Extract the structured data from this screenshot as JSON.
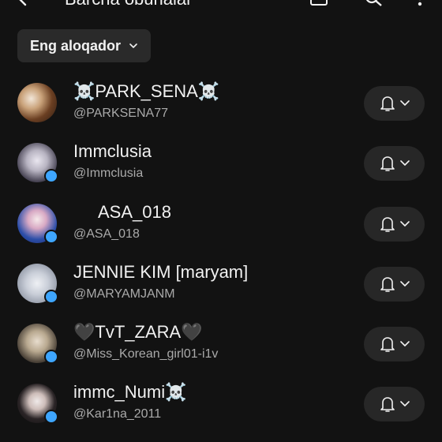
{
  "header": {
    "title": "Barcha obunalar"
  },
  "filter": {
    "label": "Eng aloqador"
  },
  "channels": [
    {
      "name": "☠️PARK_SENA☠️",
      "handle": "@PARKSENA77",
      "new_content": false
    },
    {
      "name": "Immclusia",
      "handle": "@Immclusia",
      "new_content": true
    },
    {
      "name": "ASA_018",
      "handle": "@ASA_018",
      "new_content": true
    },
    {
      "name": "JENNIE KIM [maryam]",
      "handle": "@MARYAMJANM",
      "new_content": true
    },
    {
      "name": "🖤TvT_ZARA🖤",
      "handle": "@Miss_Korean_girl01-i1v",
      "new_content": true
    },
    {
      "name": "immc_Numi☠️",
      "handle": "@Kar1na_2011",
      "new_content": true
    }
  ],
  "colors": {
    "background": "#121212",
    "chip": "#2a2a2a",
    "bell_button": "#272727",
    "new_dot": "#3ea6ff",
    "handle_text": "#aaaaaa"
  }
}
